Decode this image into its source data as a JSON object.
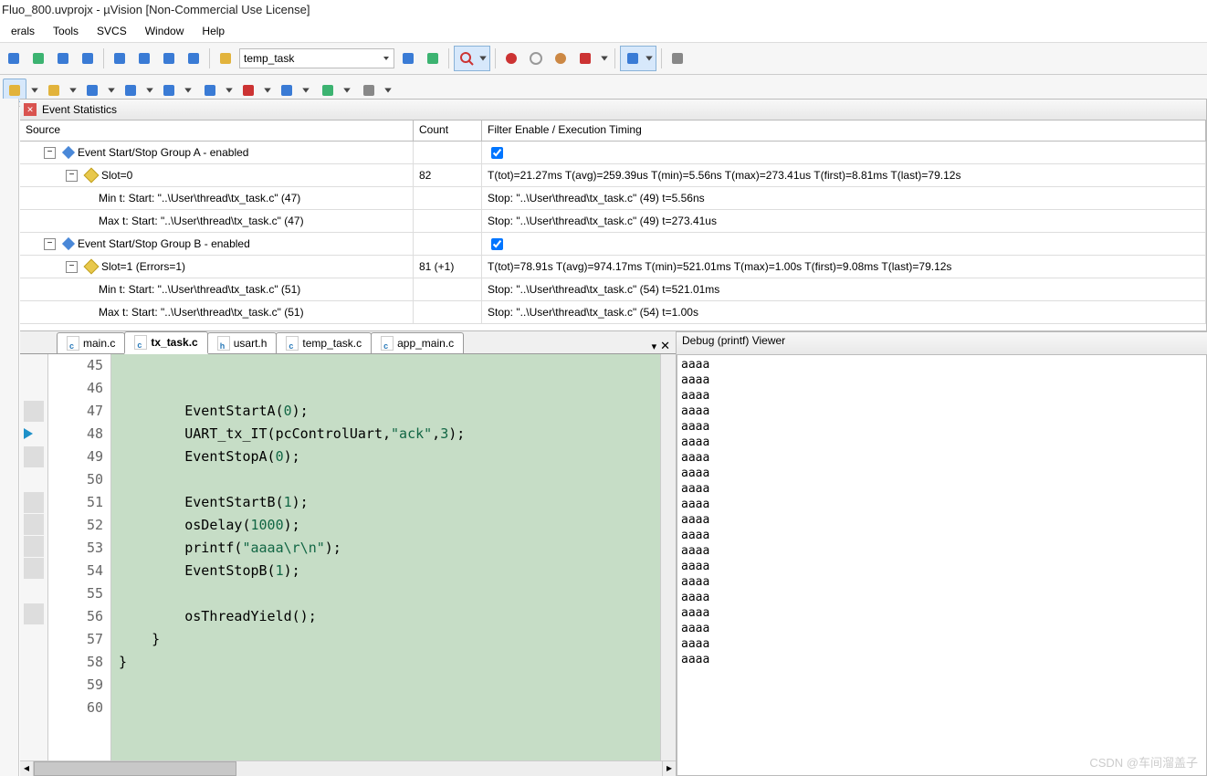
{
  "title": "Fluo_800.uvprojx - µVision  [Non-Commercial Use License]",
  "menu": {
    "items": [
      "erals",
      "Tools",
      "SVCS",
      "Window",
      "Help"
    ]
  },
  "toolbar": {
    "target": "temp_task"
  },
  "panels": {
    "eventStats": {
      "title": "Event Statistics",
      "headers": {
        "source": "Source",
        "count": "Count",
        "timing": "Filter Enable / Execution Timing"
      },
      "rows": [
        {
          "kind": "group",
          "label": "Event Start/Stop Group A - enabled",
          "count": "",
          "timingCheck": true
        },
        {
          "kind": "slot",
          "label": "Slot=0",
          "count": "82",
          "timing": "T(tot)=21.27ms T(avg)=259.39us T(min)=5.56ns T(max)=273.41us T(first)=8.81ms T(last)=79.12s"
        },
        {
          "kind": "leaf",
          "label": "Min t: Start: \"..\\User\\thread\\tx_task.c\" (47)",
          "count": "",
          "timing": "Stop: \"..\\User\\thread\\tx_task.c\" (49) t=5.56ns"
        },
        {
          "kind": "leaf",
          "label": "Max t: Start: \"..\\User\\thread\\tx_task.c\" (47)",
          "count": "",
          "timing": "Stop: \"..\\User\\thread\\tx_task.c\" (49) t=273.41us"
        },
        {
          "kind": "group",
          "label": "Event Start/Stop Group B - enabled",
          "count": "",
          "timingCheck": true
        },
        {
          "kind": "slot",
          "label": "Slot=1 (Errors=1)",
          "count": "81 (+1)",
          "timing": "T(tot)=78.91s T(avg)=974.17ms T(min)=521.01ms T(max)=1.00s T(first)=9.08ms T(last)=79.12s"
        },
        {
          "kind": "leaf",
          "label": "Min t: Start: \"..\\User\\thread\\tx_task.c\" (51)",
          "count": "",
          "timing": "Stop: \"..\\User\\thread\\tx_task.c\" (54) t=521.01ms"
        },
        {
          "kind": "leaf",
          "label": "Max t: Start: \"..\\User\\thread\\tx_task.c\" (51)",
          "count": "",
          "timing": "Stop: \"..\\User\\thread\\tx_task.c\" (54) t=1.00s"
        }
      ]
    },
    "debug": {
      "title": "Debug (printf) Viewer",
      "lines": [
        "aaaa",
        "aaaa",
        "aaaa",
        "aaaa",
        "aaaa",
        "aaaa",
        "aaaa",
        "aaaa",
        "aaaa",
        "aaaa",
        "aaaa",
        "aaaa",
        "aaaa",
        "aaaa",
        "aaaa",
        "aaaa",
        "aaaa",
        "aaaa",
        "aaaa",
        "aaaa"
      ]
    }
  },
  "editor": {
    "tabs": [
      {
        "label": "main.c",
        "type": "c",
        "active": false
      },
      {
        "label": "tx_task.c",
        "type": "c",
        "active": true
      },
      {
        "label": "usart.h",
        "type": "h",
        "active": false
      },
      {
        "label": "temp_task.c",
        "type": "c",
        "active": false
      },
      {
        "label": "app_main.c",
        "type": "c",
        "active": false
      }
    ],
    "firstLine": 45,
    "currentLine": 48,
    "lines": [
      {
        "n": 45,
        "t": ""
      },
      {
        "n": 46,
        "t": ""
      },
      {
        "n": 47,
        "t": "        EventStartA(0);",
        "bp": true
      },
      {
        "n": 48,
        "t": "        UART_tx_IT(pcControlUart,\"ack\",3);",
        "cur": true
      },
      {
        "n": 49,
        "t": "        EventStopA(0);",
        "bp": true
      },
      {
        "n": 50,
        "t": ""
      },
      {
        "n": 51,
        "t": "        EventStartB(1);",
        "bp": true
      },
      {
        "n": 52,
        "t": "        osDelay(1000);",
        "bp": true
      },
      {
        "n": 53,
        "t": "        printf(\"aaaa\\r\\n\");",
        "bp": true
      },
      {
        "n": 54,
        "t": "        EventStopB(1);",
        "bp": true
      },
      {
        "n": 55,
        "t": ""
      },
      {
        "n": 56,
        "t": "        osThreadYield();",
        "bp": true
      },
      {
        "n": 57,
        "t": "    }"
      },
      {
        "n": 58,
        "t": "}"
      },
      {
        "n": 59,
        "t": ""
      },
      {
        "n": 60,
        "t": ""
      }
    ]
  },
  "watermark": "CSDN @车间溜盖子",
  "icons": {
    "group1": [
      "bookmark-blue-icon",
      "bookmark-green-icon",
      "bookmark-prev-icon",
      "bookmark-next-icon"
    ],
    "group2": [
      "indent-left-icon",
      "indent-right-icon",
      "comment-icon",
      "uncomment-icon"
    ],
    "group3": [
      "folder-icon"
    ],
    "group4": [
      "find-icon",
      "config-icon"
    ],
    "group5": [
      "lens-red-icon"
    ],
    "group6": [
      "record-icon",
      "circle-icon",
      "refresh-icon",
      "bomb-icon"
    ],
    "group7": [
      "layout-icon"
    ],
    "group8": [
      "wrench-icon"
    ],
    "row2_seg1": [
      "window-icon",
      "grid-yellow-icon",
      "db-blue-icon",
      "layers-icon",
      "grid-blue-icon"
    ],
    "row2_seg2": [
      "stack-icon",
      "wave-red-icon",
      "table-blue-icon"
    ],
    "row2_seg3": [
      "chip-icon"
    ],
    "row2_seg4": [
      "tools-icon"
    ]
  }
}
